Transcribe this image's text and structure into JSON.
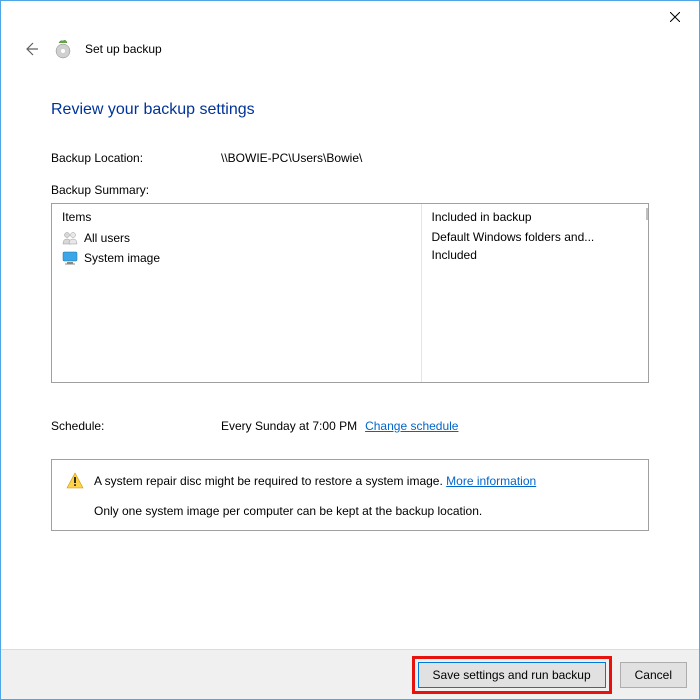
{
  "window": {
    "title": "Set up backup"
  },
  "heading": "Review your backup settings",
  "location": {
    "label": "Backup Location:",
    "value": "\\\\BOWIE-PC\\Users\\Bowie\\"
  },
  "summary": {
    "label": "Backup Summary:",
    "col_items": "Items",
    "col_included": "Included in backup",
    "rows": [
      {
        "item": "All users",
        "included": "Default Windows folders and..."
      },
      {
        "item": "System image",
        "included": "Included"
      }
    ]
  },
  "schedule": {
    "label": "Schedule:",
    "value": "Every Sunday at 7:00 PM",
    "change_link": "Change schedule"
  },
  "info": {
    "line1": "A system repair disc might be required to restore a system image.",
    "more_link": "More information",
    "line2": "Only one system image per computer can be kept at the backup location."
  },
  "buttons": {
    "save": "Save settings and run backup",
    "cancel": "Cancel"
  }
}
